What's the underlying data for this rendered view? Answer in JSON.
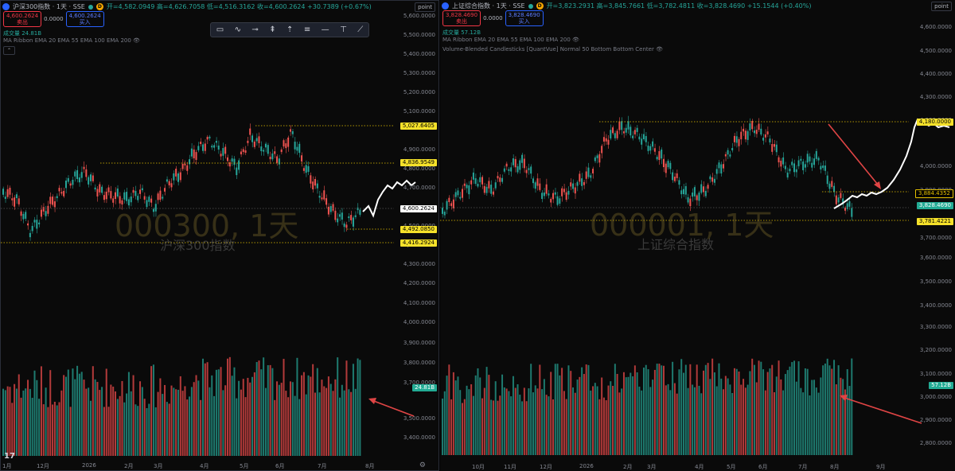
{
  "left": {
    "symbol": "沪深300指数 · 1天 · SSE",
    "exchange_badge": "D",
    "ohlc": "开=4,582.0949 高=4,626.7058 低=4,516.3162 收=4,600.2624 +30.7389 (+0.67%)",
    "sell_price": "4,600.2624",
    "sell_label": "卖出",
    "spread": "0.0000",
    "buy_price": "4,600.2624",
    "buy_label": "买入",
    "volume": "成交量  24.81B",
    "indicator": "MA Ribbon EMA 20 EMA 55 EMA 100 EMA 200",
    "watermark_code": "000300, 1天",
    "watermark_name": "沪深300指数",
    "axis_unit": "point",
    "price_ticks": [
      "5,600.0000",
      "5,500.0000",
      "5,400.0000",
      "5,300.0000",
      "5,200.0000",
      "5,100.0000",
      "4,900.0000",
      "4,800.0000",
      "4,700.0000",
      "4,500.0000",
      "4,400.0000",
      "4,300.0000",
      "4,200.0000",
      "4,100.0000",
      "4,000.0000",
      "3,900.0000",
      "3,800.0000",
      "3,700.0000",
      "3,500.0000",
      "3,400.0000"
    ],
    "price_tags": [
      {
        "text": "5,027.6405",
        "style": "yellow"
      },
      {
        "text": "4,836.9549",
        "style": "yellow"
      },
      {
        "text": "4,600.2624",
        "style": "white"
      },
      {
        "text": "4,492.0850",
        "style": "yellow"
      },
      {
        "text": "4,416.2924",
        "style": "yellow"
      },
      {
        "text": "24.81B",
        "style": "teal"
      }
    ],
    "time_ticks": [
      "1月",
      "12月",
      "2026",
      "2月",
      "3月",
      "4月",
      "5月",
      "6月",
      "7月",
      "8月"
    ],
    "tv_logo": "17"
  },
  "right": {
    "symbol": "上证综合指数 · 1天 · SSE",
    "exchange_badge": "D",
    "ohlc": "开=3,823.2931 高=3,845.7661 低=3,782.4811 收=3,828.4690 +15.1544 (+0.40%)",
    "sell_price": "3,828.4690",
    "sell_label": "卖出",
    "spread": "0.0000",
    "buy_price": "3,828.4690",
    "buy_label": "买入",
    "volume": "成交量  57.12B",
    "indicator": "MA Ribbon EMA 20 EMA 55 EMA 100 EMA 200",
    "indicator2": "Volume-Blended Candlesticks [QuantVue] Normal 50 Bottom Bottom Center",
    "watermark_code": "000001, 1天",
    "watermark_name": "上证综合指数",
    "axis_unit": "point",
    "price_ticks": [
      "4,600.0000",
      "4,500.0000",
      "4,400.0000",
      "4,300.0000",
      "4,200.0000",
      "4,000.0000",
      "3,900.0000",
      "3,700.0000",
      "3,600.0000",
      "3,500.0000",
      "3,400.0000",
      "3,300.0000",
      "3,200.0000",
      "3,100.0000",
      "3,000.0000",
      "2,900.0000",
      "2,800.0000"
    ],
    "price_tags": [
      {
        "text": "4,180.0000",
        "style": "yellow"
      },
      {
        "text": "3,884.4352",
        "style": "yellowline"
      },
      {
        "text": "3,828.4690",
        "style": "teal"
      },
      {
        "text": "3,781.4221",
        "style": "yellow"
      },
      {
        "text": "57.12B",
        "style": "teal"
      }
    ],
    "time_ticks": [
      "10月",
      "11月",
      "12月",
      "2026",
      "2月",
      "3月",
      "4月",
      "5月",
      "6月",
      "7月",
      "8月",
      "9月"
    ]
  },
  "toolbar_icons": [
    "rectangle-tool-icon",
    "path-tool-icon",
    "horizontal-ray-icon",
    "long-position-icon",
    "measure-icon",
    "horizontal-line-icon",
    "fib-retracement-icon",
    "anchored-vwap-icon",
    "trend-line-icon"
  ],
  "colors": {
    "up": "#26a69a",
    "down": "#ef5350",
    "sell": "#f23645",
    "buy": "#2962ff",
    "level": "#e6c200"
  }
}
